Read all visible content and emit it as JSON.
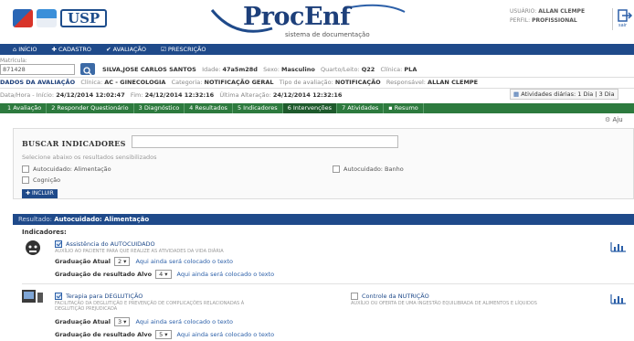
{
  "header": {
    "usp_logo": "USP",
    "app_title": "ProcEnf",
    "app_subtitle": "sistema de documentação",
    "user_label": "USUÁRIO:",
    "user_value": "ALLAN CLEMPE",
    "profile_label": "PERFIL:",
    "profile_value": "PROFISSIONAL",
    "exit_label": "sair",
    "colors": {
      "brand": "#1f4a8a",
      "tabs": "#2d7a3e"
    }
  },
  "nav": {
    "items": [
      {
        "label": "INÍCIO",
        "icon": "home-icon"
      },
      {
        "label": "CADASTRO",
        "icon": "plus-icon"
      },
      {
        "label": "AVALIAÇÃO",
        "icon": "check-icon"
      },
      {
        "label": "PRESCRIÇÃO",
        "icon": "prescription-icon"
      }
    ]
  },
  "patient": {
    "matricula_label": "Matrícula:",
    "matricula_value": "871428",
    "name": "SILVA,JOSE CARLOS SANTOS",
    "idade_label": "Idade:",
    "idade_value": "47a5m28d",
    "sexo_label": "Sexo:",
    "sexo_value": "Masculino",
    "quarto_label": "Quarto/Leito:",
    "quarto_value": "Q22",
    "clinica_label": "Clínica:",
    "clinica_value": "PLA"
  },
  "evaluation": {
    "title": "DADOS DA AVALIAÇÃO",
    "clinica_label": "Clínica:",
    "clinica_value": "AC - GINECOLOGIA",
    "categoria_label": "Categoria:",
    "categoria_value": "NOTIFICAÇÃO GERAL",
    "tipo_label": "Tipo de avaliação:",
    "tipo_value": "NOTIFICAÇÃO",
    "resp_label": "Responsável:",
    "resp_value": "ALLAN CLEMPE",
    "datahora_label": "Data/Hora - Início:",
    "inicio_value": "24/12/2014 12:02:47",
    "fim_label": "Fim:",
    "fim_value": "24/12/2014 12:32:16",
    "alteracao_label": "Última Alteração:",
    "alteracao_value": "24/12/2014 12:32:16",
    "atividades_label": "Atividades diárias: 1 Dia | 3 Dia"
  },
  "tabs": [
    {
      "label": "1 Avaliação",
      "active": false
    },
    {
      "label": "2 Responder Questionário",
      "active": false
    },
    {
      "label": "3 Diagnóstico",
      "active": false
    },
    {
      "label": "4 Resultados",
      "active": false
    },
    {
      "label": "5 Indicadores",
      "active": false
    },
    {
      "label": "6 Intervenções",
      "active": true
    },
    {
      "label": "7 Atividades",
      "active": false
    },
    {
      "label": "Resumo",
      "active": false
    }
  ],
  "help_label": "Aju",
  "search": {
    "title": "BUSCAR INDICADORES",
    "input_value": "",
    "hint": "Selecione abaixo os resultados sensibilizados",
    "options": [
      {
        "label": "Autocuidado: Alimentação",
        "checked": false
      },
      {
        "label": "Autocuidado: Banho",
        "checked": false
      },
      {
        "label": "Cognição",
        "checked": false
      }
    ],
    "add_label": "INCLUIR"
  },
  "result": {
    "prefix": "Resultado:",
    "title": "Autocuidado: Alimentação",
    "indicators_label": "Indicadores:",
    "indicators": [
      {
        "title": "Assistência do AUTOCUIDADO",
        "desc": "AUXÍLIO AO PACIENTE PARA QUE REALIZE AS ATIVIDADES DA VIDA DIÁRIA",
        "grad_atual_label": "Graduação Atual",
        "grad_atual_value": "2",
        "grad_atual_link": "Aqui ainda será colocado o texto",
        "grad_alvo_label": "Graduação de resultado Alvo",
        "grad_alvo_value": "4",
        "grad_alvo_link": "Aqui ainda será colocado o texto"
      },
      {
        "title": "Terapia para DEGLUTIÇÃO",
        "desc": "FACILITAÇÃO DA DEGLUTIÇÃO E PREVENÇÃO DE COMPLICAÇÕES RELACIONADAS À DEGLUTIÇÃO PREJUDICADA",
        "extra_title": "Controle da NUTRIÇÃO",
        "extra_desc": "AUXÍLIO OU OFERTA DE UMA INGESTÃO EQUILIBRADA DE ALIMENTOS E LÍQUIDOS",
        "grad_atual_label": "Graduação Atual",
        "grad_atual_value": "3",
        "grad_atual_link": "Aqui ainda será colocado o texto",
        "grad_alvo_label": "Graduação de resultado Alvo",
        "grad_alvo_value": "5",
        "grad_alvo_link": "Aqui ainda será colocado o texto"
      }
    ]
  }
}
